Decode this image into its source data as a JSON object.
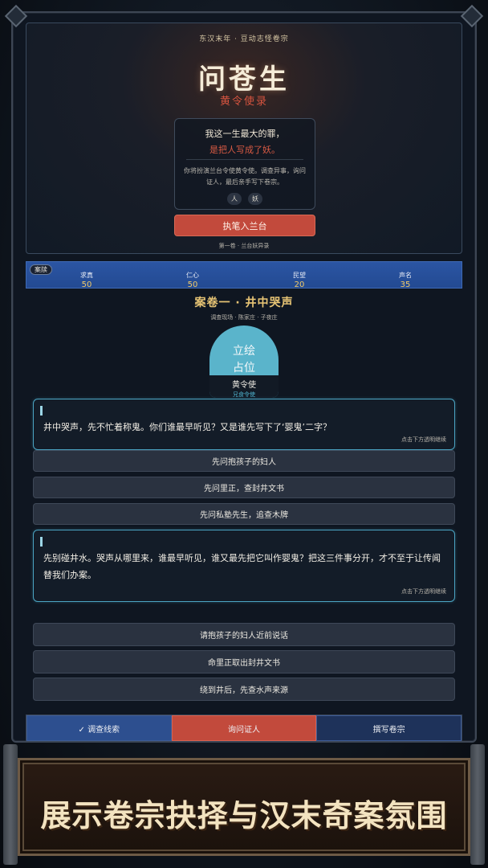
{
  "hero": {
    "dynasty_line": "东汉末年 · 豆动志怪卷宗",
    "title": "问苍生",
    "subtitle": "黄令使录",
    "quote_line1": "我这一生最大的罪，",
    "quote_line2": "是把人写成了妖。",
    "description": "你将扮演兰台令使黄令使。调查异事，询问证人，最后亲手写下卷宗。",
    "tags": [
      "人",
      "妖"
    ],
    "cta_label": "执笔入兰台",
    "volume_label": "第一卷 · 兰台妖异录"
  },
  "stats": {
    "badge": "案牍",
    "items": [
      {
        "label": "求真",
        "value": "50"
      },
      {
        "label": "仁心",
        "value": "50"
      },
      {
        "label": "民望",
        "value": "20"
      },
      {
        "label": "声名",
        "value": "35"
      }
    ]
  },
  "case": {
    "title": "案卷一 · 井中哭声",
    "meta": "调查现场 · 陈家庄 · 子夜庄",
    "portrait_placeholder_line1": "立绘",
    "portrait_placeholder_line2": "占位",
    "character_name": "黄令使",
    "character_status": "兄食令使"
  },
  "dialogues": [
    {
      "text": "井中哭声，先不忙着称鬼。你们谁最早听见？又是谁先写下了‘婴鬼’二字？",
      "hint": "点击下方透明继续"
    },
    {
      "text": "先别碰井水。哭声从哪里来，谁最早听见，谁又最先把它叫作婴鬼？把这三件事分开，才不至于让传闻替我们办案。",
      "hint": "点击下方透明继续"
    }
  ],
  "options_group1": [
    "先问抱孩子的妇人",
    "先问里正，查封井文书",
    "先问私塾先生，追查木牌"
  ],
  "options_group2": [
    "请抱孩子的妇人近前说话",
    "命里正取出封井文书",
    "绕到井后，先查水声来源"
  ],
  "tabs": [
    "✓ 调查线索",
    "询问证人",
    "撰写卷宗"
  ],
  "banner": "展示卷宗抉择与汉末奇案氛围",
  "colors": {
    "accent_red": "#c24a3c",
    "accent_gold": "#e8c575",
    "accent_blue": "#2b55a3",
    "dialogue_border": "#4ba5c3"
  }
}
